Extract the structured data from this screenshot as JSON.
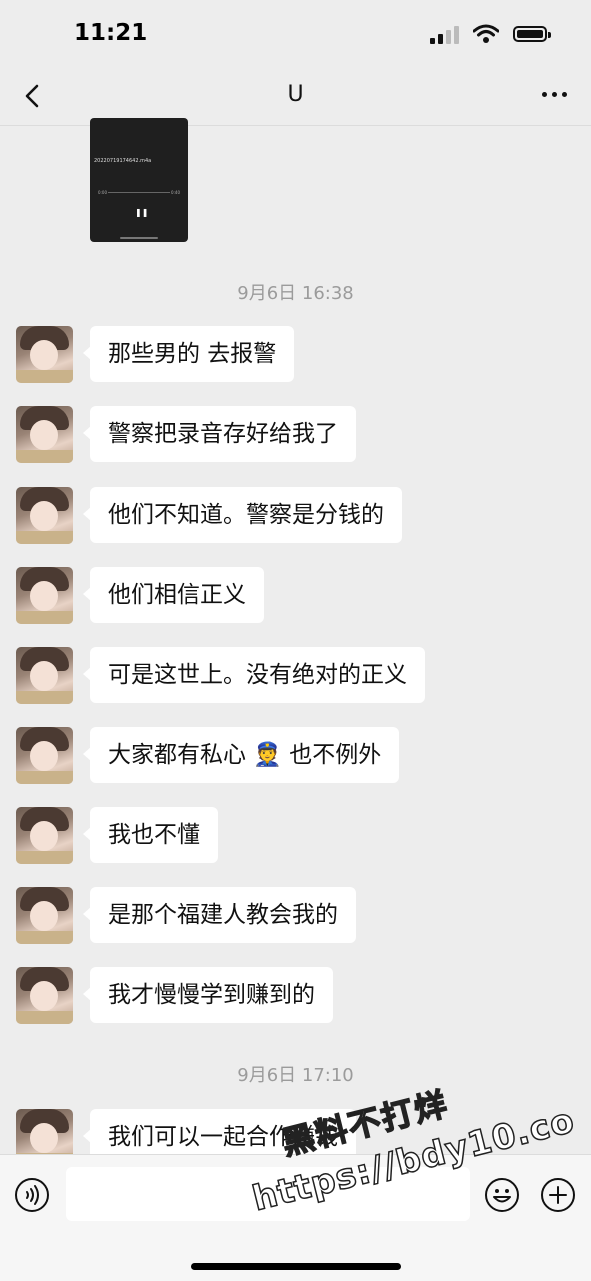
{
  "status_bar": {
    "time": "11:21"
  },
  "nav": {
    "title": "U"
  },
  "video": {
    "filename": "20220719174642.m4a",
    "time_left": "0:00",
    "time_right": "0:40"
  },
  "timestamps": [
    "9月6日 16:38",
    "9月6日 17:10"
  ],
  "messages": [
    "那些男的 去报警",
    "警察把录音存好给我了",
    "他们不知道。警察是分钱的",
    "他们相信正义",
    "可是这世上。没有绝对的正义",
    "大家都有私心 👮 也不例外",
    "我也不懂",
    "是那个福建人教会我的",
    "我才慢慢学到赚到的",
    "我们可以一起合作赚钱"
  ],
  "input": {
    "placeholder": ""
  },
  "watermark": {
    "line1": "黑料不打烊",
    "line2": "https://bdy10.co"
  }
}
